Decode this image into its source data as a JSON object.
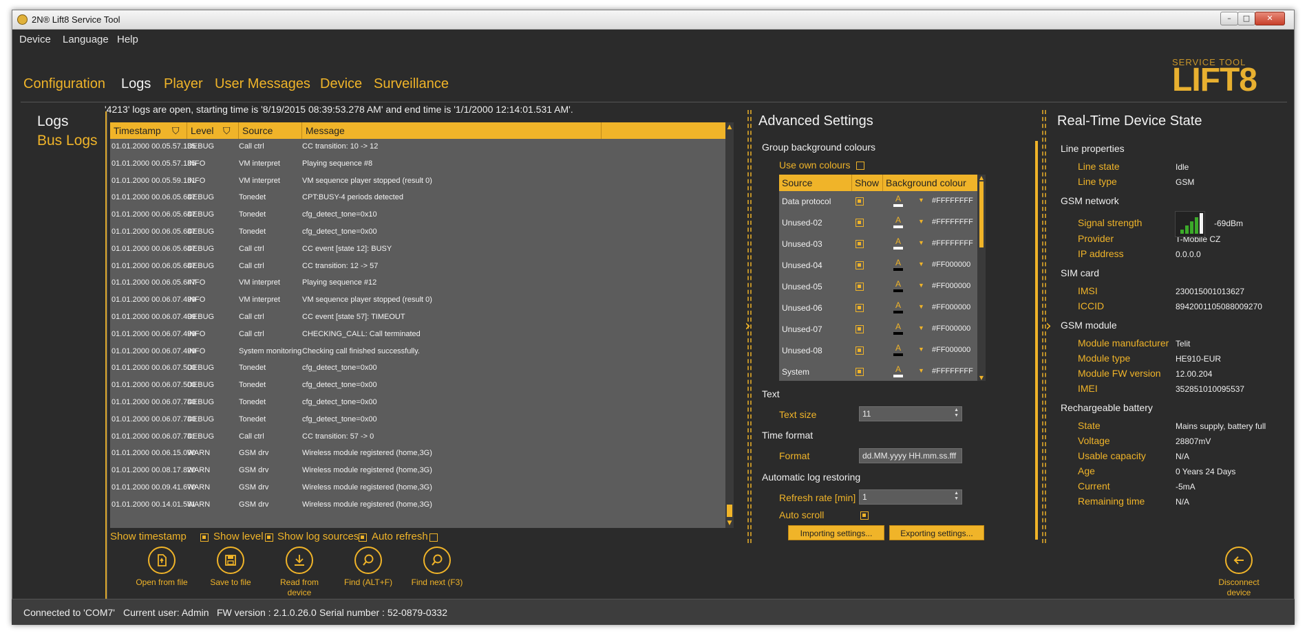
{
  "window": {
    "title": "2N® Lift8 Service Tool",
    "controls": {
      "minimize": "–",
      "maximize": "□",
      "close": "✕"
    }
  },
  "menu": {
    "items": [
      "Device",
      "Language",
      "Help"
    ]
  },
  "nav": {
    "tabs": [
      {
        "label": "Configuration",
        "active": false
      },
      {
        "label": "Logs",
        "active": true
      },
      {
        "label": "Player",
        "active": false
      },
      {
        "label": "User Messages",
        "active": false
      },
      {
        "label": "Device",
        "active": false
      },
      {
        "label": "Surveillance",
        "active": false
      }
    ]
  },
  "logo": {
    "sub": "SERVICE TOOL",
    "main": "LIFT8"
  },
  "sidenav": {
    "items": [
      "Logs",
      "Bus Logs"
    ]
  },
  "logs": {
    "info": "'4213' logs are open, starting time is '8/19/2015 08:39:53.278 AM' and end time is '1/1/2000 12:14:01.531 AM'.",
    "columns": [
      "Timestamp",
      "Level",
      "Source",
      "Message"
    ],
    "rows": [
      [
        "01.01.2000 00.05.57.135",
        "DEBUG",
        "Call ctrl",
        "CC transition: 10 -> 12"
      ],
      [
        "01.01.2000 00.05.57.135",
        "INFO",
        "VM interpret",
        "Playing sequence #8"
      ],
      [
        "01.01.2000 00.05.59.151",
        "INFO",
        "VM interpret",
        "VM sequence player stopped (result 0)"
      ],
      [
        "01.01.2000 00.06.05.647",
        "DEBUG",
        "Tonedet",
        "CPT:BUSY-4 periods detected"
      ],
      [
        "01.01.2000 00.06.05.647",
        "DEBUG",
        "Tonedet",
        "cfg_detect_tone=0x10"
      ],
      [
        "01.01.2000 00.06.05.647",
        "DEBUG",
        "Tonedet",
        "cfg_detect_tone=0x00"
      ],
      [
        "01.01.2000 00.06.05.647",
        "DEBUG",
        "Call ctrl",
        "CC event [state 12]: BUSY"
      ],
      [
        "01.01.2000 00.06.05.647",
        "DEBUG",
        "Call ctrl",
        "CC transition: 12 -> 57"
      ],
      [
        "01.01.2000 00.06.05.647",
        "INFO",
        "VM interpret",
        "Playing sequence #12"
      ],
      [
        "01.01.2000 00.06.07.499",
        "INFO",
        "VM interpret",
        "VM sequence player stopped (result 0)"
      ],
      [
        "01.01.2000 00.06.07.499",
        "DEBUG",
        "Call ctrl",
        "CC event [state 57]: TIMEOUT"
      ],
      [
        "01.01.2000 00.06.07.499",
        "INFO",
        "Call ctrl",
        "CHECKING_CALL: Call terminated"
      ],
      [
        "01.01.2000 00.06.07.499",
        "INFO",
        "System monitoring",
        "Checking call finished successfully."
      ],
      [
        "01.01.2000 00.06.07.500",
        "DEBUG",
        "Tonedet",
        "cfg_detect_tone=0x00"
      ],
      [
        "01.01.2000 00.06.07.500",
        "DEBUG",
        "Tonedet",
        "cfg_detect_tone=0x00"
      ],
      [
        "01.01.2000 00.06.07.740",
        "DEBUG",
        "Tonedet",
        "cfg_detect_tone=0x00"
      ],
      [
        "01.01.2000 00.06.07.740",
        "DEBUG",
        "Tonedet",
        "cfg_detect_tone=0x00"
      ],
      [
        "01.01.2000 00.06.07.741",
        "DEBUG",
        "Call ctrl",
        "CC transition: 57 -> 0"
      ],
      [
        "01.01.2000 00.06.15.090",
        "WARN",
        "GSM drv",
        "Wireless module registered (home,3G)"
      ],
      [
        "01.01.2000 00.08.17.820",
        "WARN",
        "GSM drv",
        "Wireless module registered (home,3G)"
      ],
      [
        "01.01.2000 00.09.41.670",
        "WARN",
        "GSM drv",
        "Wireless module registered (home,3G)"
      ],
      [
        "01.01.2000 00.14.01.531",
        "WARN",
        "GSM drv",
        "Wireless module registered (home,3G)"
      ]
    ],
    "options": [
      {
        "label": "Show timestamp",
        "checked": true
      },
      {
        "label": "Show level",
        "checked": true
      },
      {
        "label": "Show log sources",
        "checked": true
      },
      {
        "label": "Auto refresh",
        "checked": false
      }
    ]
  },
  "toolbar": {
    "buttons": [
      {
        "name": "open-from-file",
        "label1": "Open from file",
        "label2": "",
        "icon": "file-open-icon"
      },
      {
        "name": "save-to-file",
        "label1": "Save to file",
        "label2": "",
        "icon": "floppy-icon"
      },
      {
        "name": "read-from-device",
        "label1": "Read from",
        "label2": "device",
        "icon": "download-icon"
      },
      {
        "name": "find",
        "label1": "Find (ALT+F)",
        "label2": "",
        "icon": "magnifier-icon"
      },
      {
        "name": "find-next",
        "label1": "Find next (F3)",
        "label2": "",
        "icon": "magnifier-icon"
      }
    ],
    "disconnect": {
      "label1": "Disconnect",
      "label2": "device",
      "icon": "back-arrow-icon"
    }
  },
  "advanced": {
    "title": "Advanced Settings",
    "group_bg_label": "Group background colours",
    "use_own_label": "Use own colours",
    "use_own_checked": false,
    "columns": [
      "Source",
      "Show",
      "Background colour"
    ],
    "rows": [
      {
        "source": "Data protocol",
        "hex": "#FFFFFFFF",
        "swatch": "#ffffff"
      },
      {
        "source": "Unused-02",
        "hex": "#FFFFFFFF",
        "swatch": "#ffffff"
      },
      {
        "source": "Unused-03",
        "hex": "#FFFFFFFF",
        "swatch": "#ffffff"
      },
      {
        "source": "Unused-04",
        "hex": "#FF000000",
        "swatch": "#000000"
      },
      {
        "source": "Unused-05",
        "hex": "#FF000000",
        "swatch": "#000000"
      },
      {
        "source": "Unused-06",
        "hex": "#FF000000",
        "swatch": "#000000"
      },
      {
        "source": "Unused-07",
        "hex": "#FF000000",
        "swatch": "#000000"
      },
      {
        "source": "Unused-08",
        "hex": "#FF000000",
        "swatch": "#000000"
      },
      {
        "source": "System",
        "hex": "#FFFFFFFF",
        "swatch": "#ffffff"
      }
    ],
    "text_section": "Text",
    "text_size_label": "Text size",
    "text_size_value": "11",
    "time_format_section": "Time format",
    "format_label": "Format",
    "format_value": "dd.MM.yyyy HH.mm.ss.fff",
    "auto_restore_section": "Automatic log restoring",
    "refresh_label": "Refresh rate [min]",
    "refresh_value": "1",
    "auto_scroll_label": "Auto scroll",
    "auto_scroll_checked": true,
    "import_button": "Importing settings...",
    "export_button": "Exporting settings..."
  },
  "realtime": {
    "title": "Real-Time Device State",
    "sections": [
      {
        "header": "Line properties",
        "items": [
          {
            "label": "Line state",
            "value": "Idle"
          },
          {
            "label": "Line type",
            "value": "GSM"
          }
        ]
      },
      {
        "header": "GSM network",
        "items": [
          {
            "label": "Signal strength",
            "value": "-69dBm"
          },
          {
            "label": "Provider",
            "value": "T-Mobile CZ"
          },
          {
            "label": "IP address",
            "value": "0.0.0.0"
          }
        ]
      },
      {
        "header": "SIM card",
        "items": [
          {
            "label": "IMSI",
            "value": "230015001013627"
          },
          {
            "label": "ICCID",
            "value": "8942001105088009270"
          }
        ]
      },
      {
        "header": "GSM module",
        "items": [
          {
            "label": "Module manufacturer",
            "value": "Telit"
          },
          {
            "label": "Module type",
            "value": "HE910-EUR"
          },
          {
            "label": "Module FW version",
            "value": "12.00.204"
          },
          {
            "label": "IMEI",
            "value": "352851010095537"
          }
        ]
      },
      {
        "header": "Rechargeable battery",
        "items": [
          {
            "label": "State",
            "value": "Mains supply, battery full"
          },
          {
            "label": "Voltage",
            "value": "28807mV"
          },
          {
            "label": "Usable capacity",
            "value": "N/A"
          },
          {
            "label": "Age",
            "value": "0 Years 24 Days"
          },
          {
            "label": "Current",
            "value": "-5mA"
          },
          {
            "label": "Remaining time",
            "value": "N/A"
          }
        ]
      }
    ]
  },
  "status": {
    "connected": "Connected to 'COM7'",
    "user": "Current user: Admin",
    "fw": "FW version : 2.1.0.26.0",
    "serial": "Serial number : 52-0879-0332"
  },
  "colors": {
    "accent": "#f0b429",
    "background": "#2b2b2b",
    "grid": "#5c5c5c"
  }
}
